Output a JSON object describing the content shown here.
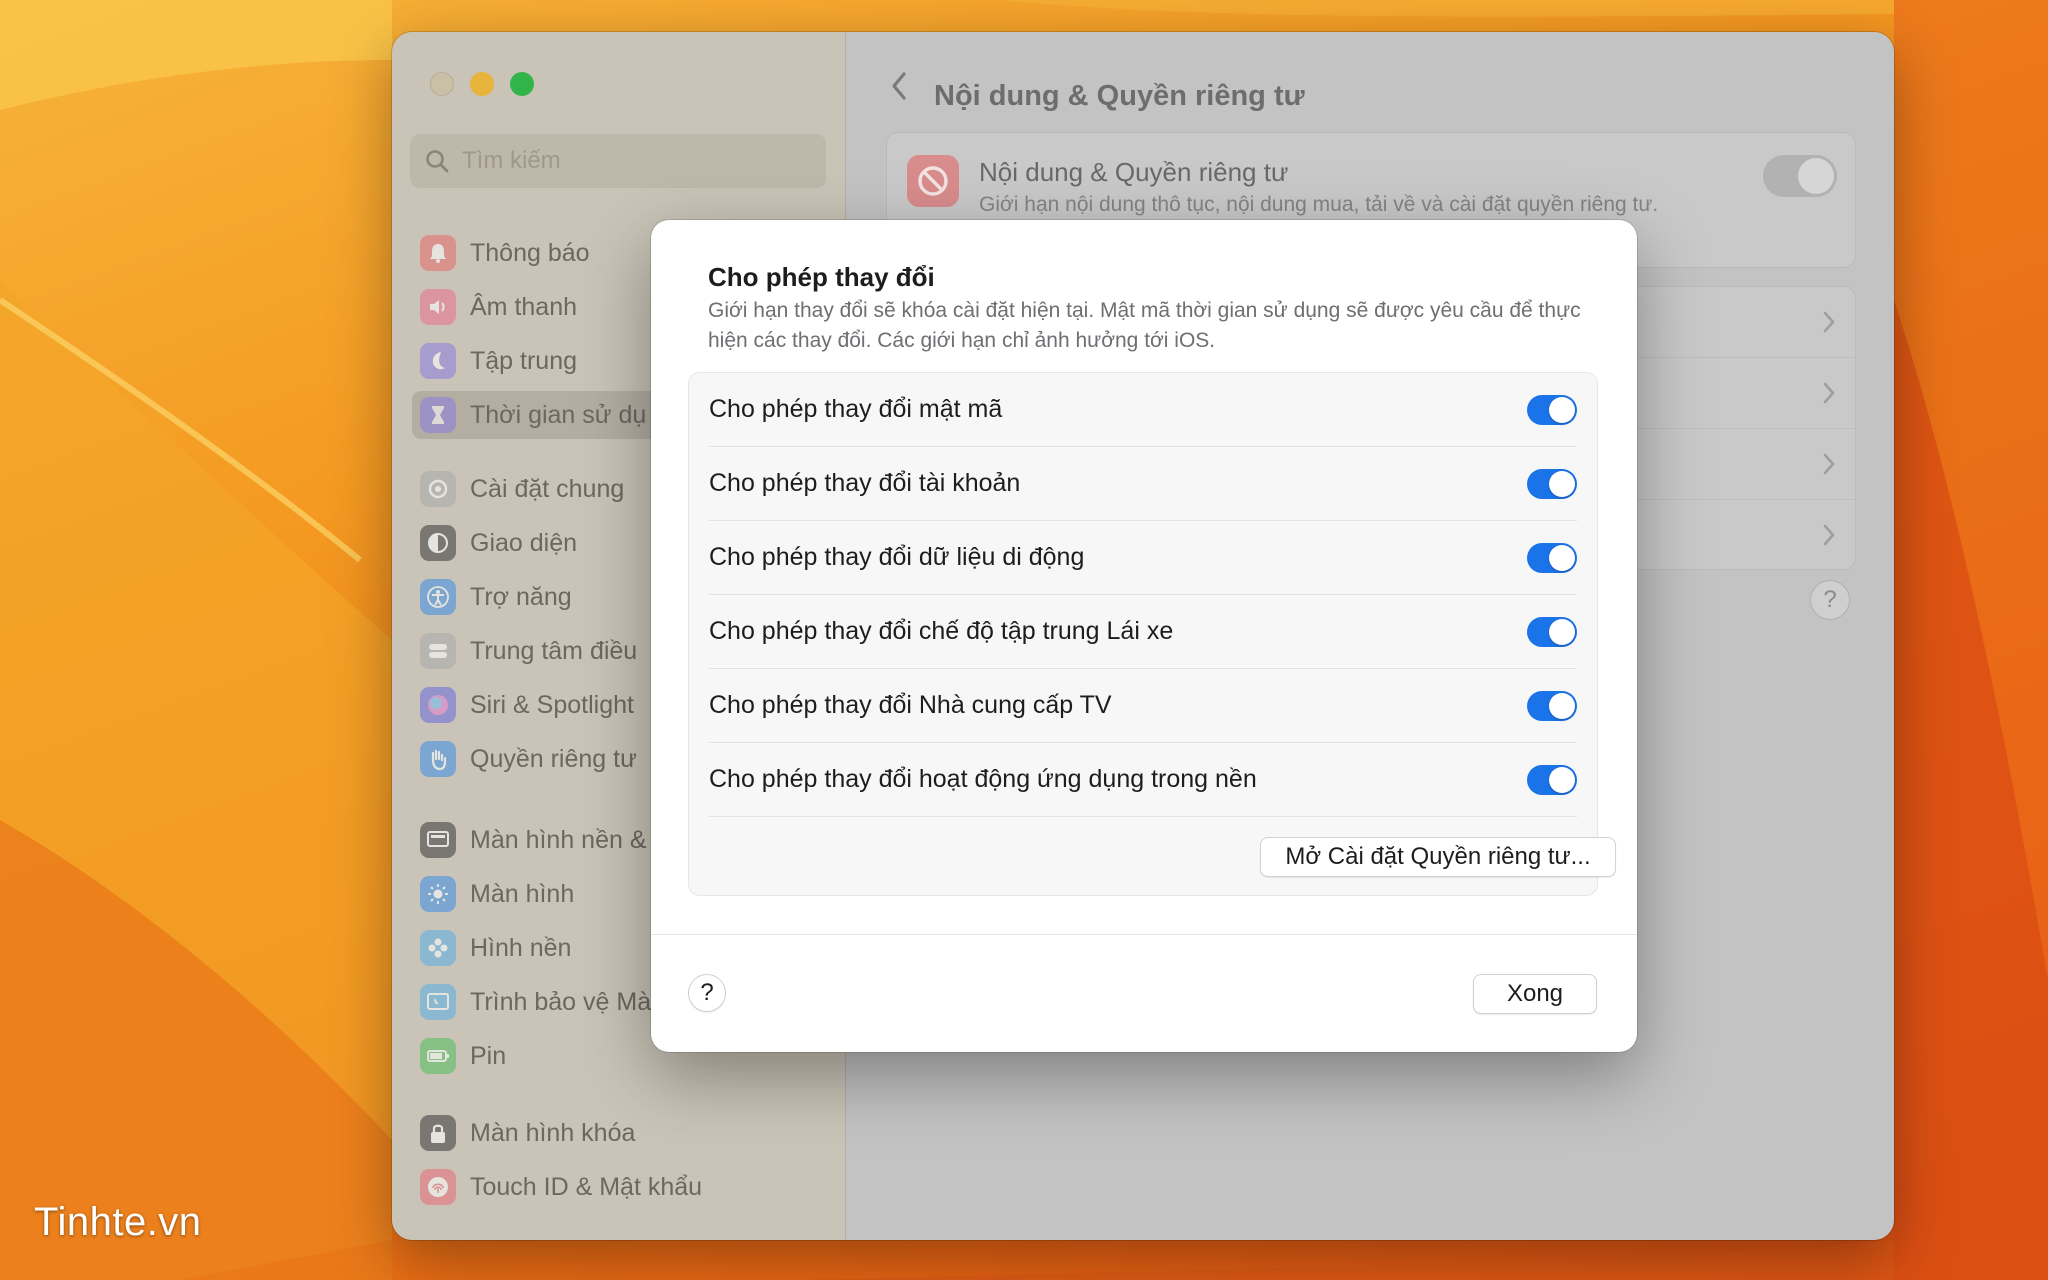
{
  "watermark": "Tinhte.vn",
  "colors": {
    "accent": "#1a73e8",
    "wallpaper": "#f0901c"
  },
  "sidebar": {
    "search_placeholder": "Tìm kiếm",
    "items": [
      {
        "label": "Thông báo",
        "icon": "bell-icon",
        "color": "#e86a6a"
      },
      {
        "label": "Âm thanh",
        "icon": "speaker-icon",
        "color": "#e8708a"
      },
      {
        "label": "Tập trung",
        "icon": "moon-icon",
        "color": "#8a7de0"
      },
      {
        "label": "Thời gian sử dụ",
        "icon": "hourglass-icon",
        "color": "#8a7de0",
        "selected": true
      },
      {
        "label": "Cài đặt chung",
        "icon": "gear-icon",
        "color": "#a9a9a9"
      },
      {
        "label": "Giao diện",
        "icon": "appearance-icon",
        "color": "#3a3a3a"
      },
      {
        "label": "Trợ năng",
        "icon": "accessibility-icon",
        "color": "#3d8ee8"
      },
      {
        "label": "Trung tâm điều",
        "icon": "control-center-icon",
        "color": "#a9a9a9"
      },
      {
        "label": "Siri & Spotlight",
        "icon": "siri-icon",
        "color": "#6a6adf"
      },
      {
        "label": "Quyền riêng tư",
        "icon": "hand-icon",
        "color": "#3d8ee8"
      },
      {
        "label": "Màn hình nền &",
        "icon": "desktop-icon",
        "color": "#3a3a3a"
      },
      {
        "label": "Màn hình",
        "icon": "brightness-icon",
        "color": "#3d8ee8"
      },
      {
        "label": "Hình nền",
        "icon": "flower-icon",
        "color": "#5ab0e8"
      },
      {
        "label": "Trình bảo vệ Mà",
        "icon": "screensaver-icon",
        "color": "#5ab0e8"
      },
      {
        "label": "Pin",
        "icon": "battery-icon",
        "color": "#4cbf5a"
      },
      {
        "label": "Màn hình khóa",
        "icon": "lock-icon",
        "color": "#3a3a3a"
      },
      {
        "label": "Touch ID & Mật khẩu",
        "icon": "fingerprint-icon",
        "color": "#e86a7a"
      }
    ]
  },
  "main": {
    "title": "Nội dung & Quyền riêng tư",
    "card": {
      "title": "Nội dung & Quyền riêng tư",
      "description": "Giới hạn nội dung thô tục, nội dung mua, tải về và cài đặt quyền riêng tư."
    },
    "help_label": "?"
  },
  "sheet": {
    "title": "Cho phép thay đổi",
    "description": "Giới hạn thay đổi sẽ khóa cài đặt hiện tại. Mật mã thời gian sử dụng sẽ được yêu cầu để thực hiện các thay đổi. Các giới hạn chỉ ảnh hưởng tới iOS.",
    "options": [
      {
        "label": "Cho phép thay đổi mật mã",
        "on": true
      },
      {
        "label": "Cho phép thay đổi tài khoản",
        "on": true
      },
      {
        "label": "Cho phép thay đổi dữ liệu di động",
        "on": true
      },
      {
        "label": "Cho phép thay đổi chế độ tập trung Lái xe",
        "on": true
      },
      {
        "label": "Cho phép thay đổi Nhà cung cấp TV",
        "on": true
      },
      {
        "label": "Cho phép thay đổi hoạt động ứng dụng trong nền",
        "on": true
      }
    ],
    "open_button": "Mở Cài đặt Quyền riêng tư...",
    "help_label": "?",
    "done_label": "Xong"
  }
}
